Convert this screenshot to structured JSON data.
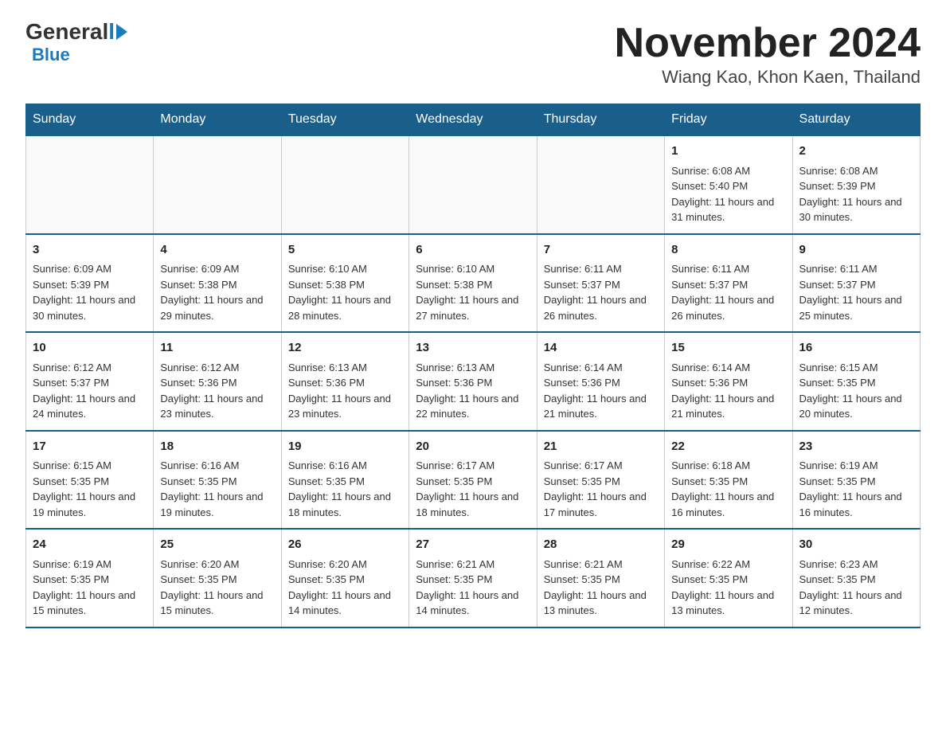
{
  "header": {
    "logo_general": "General",
    "logo_blue": "Blue",
    "title": "November 2024",
    "subtitle": "Wiang Kao, Khon Kaen, Thailand"
  },
  "days_of_week": [
    "Sunday",
    "Monday",
    "Tuesday",
    "Wednesday",
    "Thursday",
    "Friday",
    "Saturday"
  ],
  "weeks": [
    [
      {
        "day": "",
        "info": ""
      },
      {
        "day": "",
        "info": ""
      },
      {
        "day": "",
        "info": ""
      },
      {
        "day": "",
        "info": ""
      },
      {
        "day": "",
        "info": ""
      },
      {
        "day": "1",
        "info": "Sunrise: 6:08 AM\nSunset: 5:40 PM\nDaylight: 11 hours and 31 minutes."
      },
      {
        "day": "2",
        "info": "Sunrise: 6:08 AM\nSunset: 5:39 PM\nDaylight: 11 hours and 30 minutes."
      }
    ],
    [
      {
        "day": "3",
        "info": "Sunrise: 6:09 AM\nSunset: 5:39 PM\nDaylight: 11 hours and 30 minutes."
      },
      {
        "day": "4",
        "info": "Sunrise: 6:09 AM\nSunset: 5:38 PM\nDaylight: 11 hours and 29 minutes."
      },
      {
        "day": "5",
        "info": "Sunrise: 6:10 AM\nSunset: 5:38 PM\nDaylight: 11 hours and 28 minutes."
      },
      {
        "day": "6",
        "info": "Sunrise: 6:10 AM\nSunset: 5:38 PM\nDaylight: 11 hours and 27 minutes."
      },
      {
        "day": "7",
        "info": "Sunrise: 6:11 AM\nSunset: 5:37 PM\nDaylight: 11 hours and 26 minutes."
      },
      {
        "day": "8",
        "info": "Sunrise: 6:11 AM\nSunset: 5:37 PM\nDaylight: 11 hours and 26 minutes."
      },
      {
        "day": "9",
        "info": "Sunrise: 6:11 AM\nSunset: 5:37 PM\nDaylight: 11 hours and 25 minutes."
      }
    ],
    [
      {
        "day": "10",
        "info": "Sunrise: 6:12 AM\nSunset: 5:37 PM\nDaylight: 11 hours and 24 minutes."
      },
      {
        "day": "11",
        "info": "Sunrise: 6:12 AM\nSunset: 5:36 PM\nDaylight: 11 hours and 23 minutes."
      },
      {
        "day": "12",
        "info": "Sunrise: 6:13 AM\nSunset: 5:36 PM\nDaylight: 11 hours and 23 minutes."
      },
      {
        "day": "13",
        "info": "Sunrise: 6:13 AM\nSunset: 5:36 PM\nDaylight: 11 hours and 22 minutes."
      },
      {
        "day": "14",
        "info": "Sunrise: 6:14 AM\nSunset: 5:36 PM\nDaylight: 11 hours and 21 minutes."
      },
      {
        "day": "15",
        "info": "Sunrise: 6:14 AM\nSunset: 5:36 PM\nDaylight: 11 hours and 21 minutes."
      },
      {
        "day": "16",
        "info": "Sunrise: 6:15 AM\nSunset: 5:35 PM\nDaylight: 11 hours and 20 minutes."
      }
    ],
    [
      {
        "day": "17",
        "info": "Sunrise: 6:15 AM\nSunset: 5:35 PM\nDaylight: 11 hours and 19 minutes."
      },
      {
        "day": "18",
        "info": "Sunrise: 6:16 AM\nSunset: 5:35 PM\nDaylight: 11 hours and 19 minutes."
      },
      {
        "day": "19",
        "info": "Sunrise: 6:16 AM\nSunset: 5:35 PM\nDaylight: 11 hours and 18 minutes."
      },
      {
        "day": "20",
        "info": "Sunrise: 6:17 AM\nSunset: 5:35 PM\nDaylight: 11 hours and 18 minutes."
      },
      {
        "day": "21",
        "info": "Sunrise: 6:17 AM\nSunset: 5:35 PM\nDaylight: 11 hours and 17 minutes."
      },
      {
        "day": "22",
        "info": "Sunrise: 6:18 AM\nSunset: 5:35 PM\nDaylight: 11 hours and 16 minutes."
      },
      {
        "day": "23",
        "info": "Sunrise: 6:19 AM\nSunset: 5:35 PM\nDaylight: 11 hours and 16 minutes."
      }
    ],
    [
      {
        "day": "24",
        "info": "Sunrise: 6:19 AM\nSunset: 5:35 PM\nDaylight: 11 hours and 15 minutes."
      },
      {
        "day": "25",
        "info": "Sunrise: 6:20 AM\nSunset: 5:35 PM\nDaylight: 11 hours and 15 minutes."
      },
      {
        "day": "26",
        "info": "Sunrise: 6:20 AM\nSunset: 5:35 PM\nDaylight: 11 hours and 14 minutes."
      },
      {
        "day": "27",
        "info": "Sunrise: 6:21 AM\nSunset: 5:35 PM\nDaylight: 11 hours and 14 minutes."
      },
      {
        "day": "28",
        "info": "Sunrise: 6:21 AM\nSunset: 5:35 PM\nDaylight: 11 hours and 13 minutes."
      },
      {
        "day": "29",
        "info": "Sunrise: 6:22 AM\nSunset: 5:35 PM\nDaylight: 11 hours and 13 minutes."
      },
      {
        "day": "30",
        "info": "Sunrise: 6:23 AM\nSunset: 5:35 PM\nDaylight: 11 hours and 12 minutes."
      }
    ]
  ]
}
